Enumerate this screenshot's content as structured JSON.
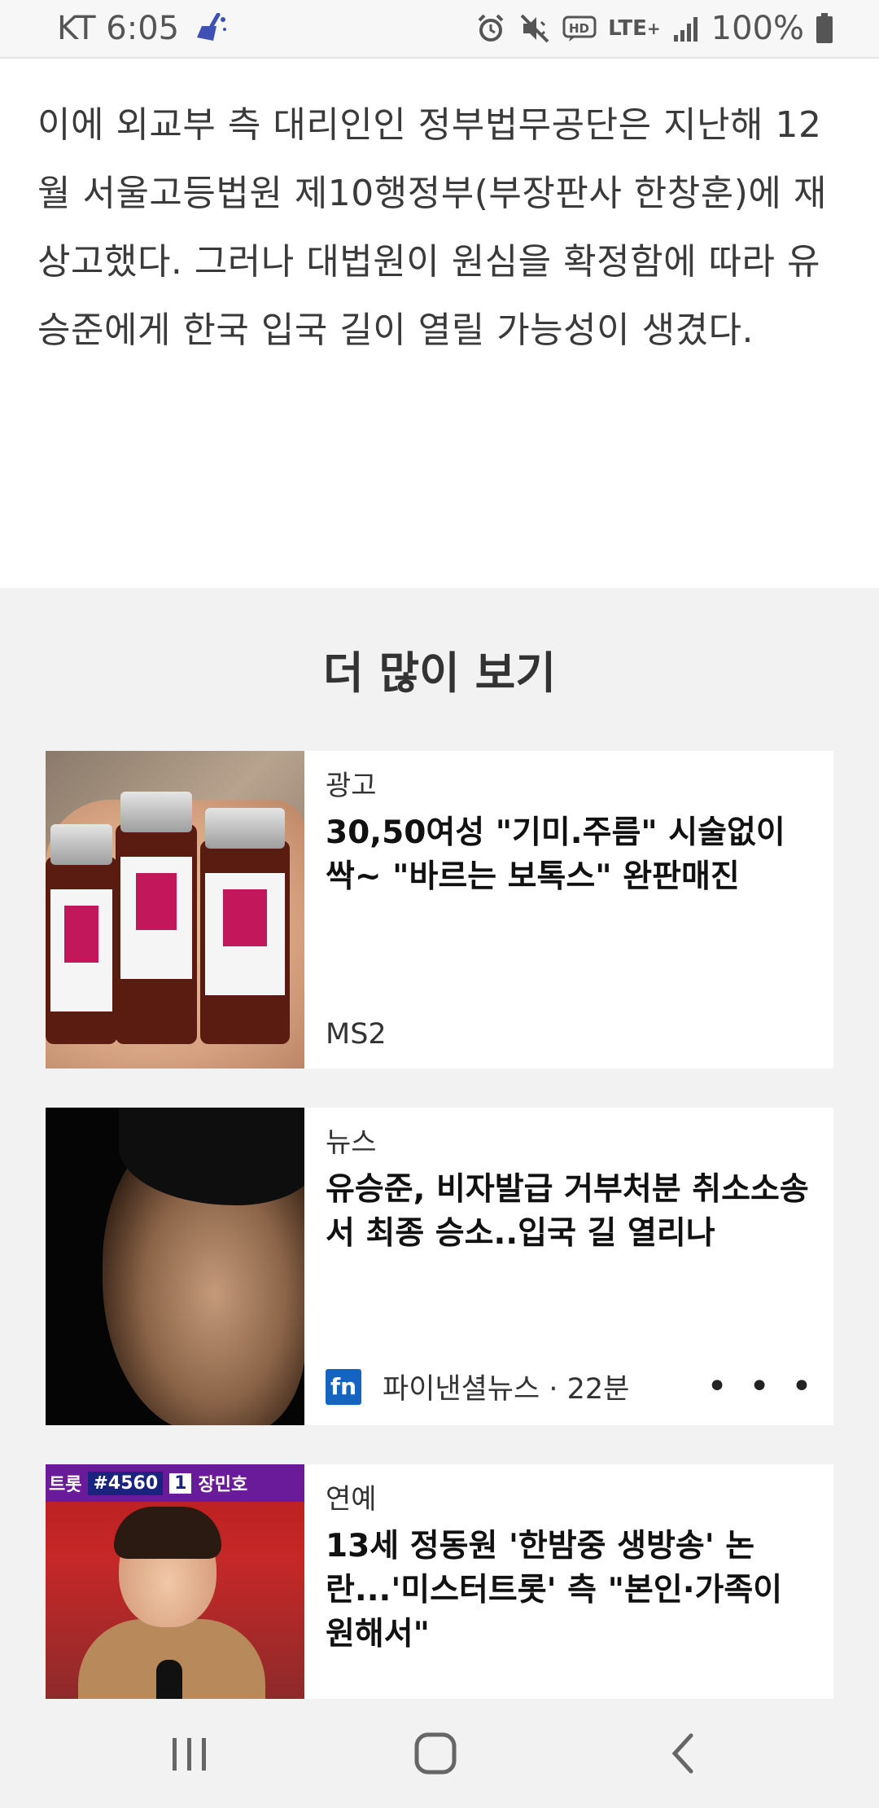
{
  "status_bar": {
    "carrier_time": "KT 6:05",
    "network": "LTE",
    "battery": "100%",
    "icons": [
      "cleaner-broom-icon",
      "alarm-icon",
      "mute-vibrate-icon",
      "hd-voice-icon",
      "lte-icon",
      "signal-icon",
      "battery-icon"
    ]
  },
  "article": {
    "paragraph": "이에 외교부 측 대리인인 정부법무공단은 지난해 12월 서울고등법원 제10행정부(부장판사 한창훈)에 재상고했다. 그러나 대법원이 원심을 확정함에 따라 유승준에게 한국 입국 길이 열릴 가능성이 생겼다."
  },
  "more": {
    "title": "더 많이 보기",
    "cards": [
      {
        "category": "광고",
        "headline": "30,50여성 \"기미.주름\" 시술없이 싹~  \"바르는 보톡스\" 완판매진",
        "source": "MS2"
      },
      {
        "category": "뉴스",
        "headline": "유승준, 비자발급 거부처분 취소소송서 최종 승소..입국 길 열리나",
        "source_logo": "fn",
        "source": "파이낸셜뉴스 · 22분",
        "more_menu": "• • •"
      },
      {
        "category": "연예",
        "headline": "13세 정동원 '한밤중 생방송' 논란...'미스터트롯' 측 \"본인·가족이 원해서\"",
        "thumb_banner_left": "트롯",
        "thumb_banner_num": "#4560",
        "thumb_banner_rank": "1",
        "thumb_banner_name": "장민호"
      }
    ]
  },
  "colors": {
    "article_bg": "#ffffff",
    "section_bg": "#f2f2f2",
    "fn_logo": "#1565c0"
  }
}
